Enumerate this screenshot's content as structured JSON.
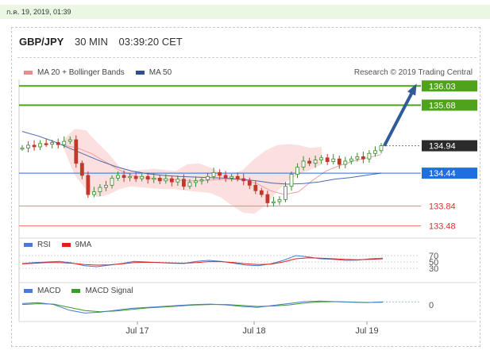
{
  "timestamp": "ก.ค. 19, 2019, 01:39",
  "header": {
    "pair": "GBP/JPY",
    "interval": "30 MIN",
    "time": "03:39:20 CET"
  },
  "legend": {
    "ma20_label": "MA 20 + Bollinger Bands",
    "ma50_label": "MA 50",
    "credit": "Research © 2019 Trading Central",
    "rsi_label": "RSI",
    "rsi_ma_label": "9MA",
    "macd_label": "MACD",
    "macd_signal_label": "MACD Signal"
  },
  "colors": {
    "green_level": "#4ea31a",
    "support_level": "#f08080",
    "blue_level": "#1f6fe0",
    "last_price": "#2b2b2b",
    "bollinger_fill": "#fbdada",
    "ma20": "#f0a0a0",
    "ma50": "#4a6ab0",
    "candle_up": "#3a8a2a",
    "candle_down": "#c0392b",
    "arrow": "#2f5b9a"
  },
  "chart_data": {
    "type": "candlestick",
    "symbol": "GBP/JPY",
    "x_ticks": [
      "Jul 17",
      "Jul 18",
      "Jul 19"
    ],
    "ylim": [
      133.4,
      136.15
    ],
    "price_levels": [
      {
        "value": 136.03,
        "label": "136.03",
        "kind": "resistance"
      },
      {
        "value": 135.68,
        "label": "135.68",
        "kind": "resistance"
      },
      {
        "value": 134.94,
        "label": "134.94",
        "kind": "last"
      },
      {
        "value": 134.44,
        "label": "134.44",
        "kind": "pivot"
      },
      {
        "value": 133.84,
        "label": "133.84",
        "kind": "support"
      },
      {
        "value": 133.48,
        "label": "133.48",
        "kind": "support"
      }
    ],
    "close": [
      134.9,
      134.95,
      134.92,
      134.98,
      134.97,
      135.0,
      134.96,
      135.02,
      135.05,
      134.62,
      134.4,
      134.05,
      134.1,
      134.18,
      134.22,
      134.35,
      134.4,
      134.36,
      134.38,
      134.34,
      134.38,
      134.33,
      134.35,
      134.3,
      134.34,
      134.28,
      134.33,
      134.2,
      134.27,
      134.3,
      134.32,
      134.38,
      134.45,
      134.4,
      134.35,
      134.38,
      134.34,
      134.3,
      134.22,
      134.12,
      134.05,
      133.9,
      133.92,
      133.96,
      134.2,
      134.42,
      134.55,
      134.66,
      134.62,
      134.68,
      134.72,
      134.65,
      134.7,
      134.6,
      134.66,
      134.7,
      134.74,
      134.7,
      134.8,
      134.85,
      134.94
    ],
    "open_offsets_note_absent": true,
    "ma20": [
      134.95,
      134.9,
      134.8,
      134.65,
      134.5,
      134.4,
      134.35,
      134.33,
      134.32,
      134.3,
      134.3,
      134.32,
      134.33,
      134.32,
      134.25,
      134.12,
      134.05,
      134.1,
      134.3,
      134.48,
      134.58,
      134.66,
      134.72,
      134.78
    ],
    "bb_upper": [
      135.05,
      135.25,
      135.22,
      135.0,
      134.8,
      134.55,
      134.48,
      134.5,
      134.52,
      134.5,
      134.48,
      134.6,
      134.62,
      134.55,
      134.45,
      134.42,
      134.5,
      134.7,
      134.85,
      134.95,
      134.97,
      134.95,
      134.9,
      134.92
    ],
    "bb_lower": [
      134.9,
      134.4,
      134.15,
      134.0,
      134.05,
      134.15,
      134.2,
      134.18,
      134.16,
      134.15,
      134.15,
      134.12,
      134.1,
      134.08,
      134.0,
      133.85,
      133.72,
      133.7,
      133.85,
      134.1,
      134.3,
      134.42,
      134.5,
      134.6
    ],
    "ma50": [
      135.2,
      135.12,
      135.02,
      134.9,
      134.78,
      134.66,
      134.56,
      134.48,
      134.43,
      134.4,
      134.38,
      134.37,
      134.36,
      134.35,
      134.33,
      134.3,
      134.26,
      134.24,
      134.25,
      134.28,
      134.33,
      134.36,
      134.4,
      134.44
    ],
    "projection": {
      "from": 134.94,
      "to": 136.03
    },
    "rsi": {
      "levels": [
        "70",
        "50",
        "30"
      ],
      "rsi": [
        45,
        48,
        50,
        52,
        47,
        38,
        35,
        40,
        45,
        52,
        50,
        48,
        46,
        45,
        52,
        55,
        52,
        46,
        40,
        38,
        44,
        55,
        70,
        66,
        60,
        58,
        55,
        56,
        60,
        62
      ],
      "ma9": [
        44,
        46,
        48,
        48,
        46,
        42,
        40,
        41,
        44,
        48,
        49,
        48,
        47,
        46,
        48,
        51,
        51,
        48,
        44,
        42,
        43,
        50,
        60,
        63,
        62,
        60,
        58,
        57,
        58,
        60
      ]
    },
    "macd": {
      "levels": [
        "0"
      ],
      "macd": [
        0.15,
        0.2,
        0.1,
        -0.2,
        -0.35,
        -0.3,
        -0.2,
        -0.1,
        -0.05,
        0.0,
        0.05,
        0.1,
        0.12,
        0.08,
        0.0,
        -0.05,
        0.05,
        0.15,
        0.25,
        0.28,
        0.25,
        0.22,
        0.2,
        0.24
      ],
      "signal": [
        0.1,
        0.14,
        0.12,
        -0.05,
        -0.22,
        -0.28,
        -0.24,
        -0.16,
        -0.08,
        -0.03,
        0.02,
        0.07,
        0.1,
        0.1,
        0.05,
        0.0,
        0.02,
        0.08,
        0.18,
        0.24,
        0.25,
        0.23,
        0.21,
        0.22
      ]
    }
  }
}
